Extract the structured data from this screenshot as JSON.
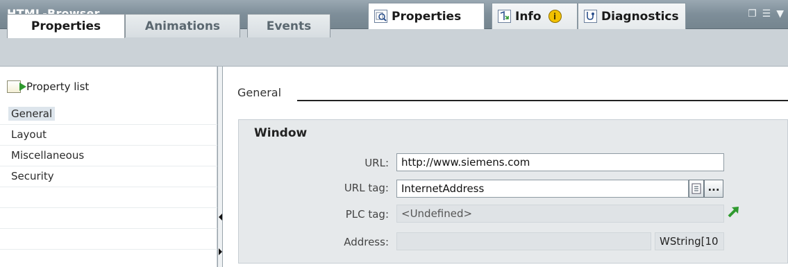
{
  "header": {
    "title": "HTML-Browser",
    "tabs": [
      {
        "label": "Properties",
        "icon": "properties-icon"
      },
      {
        "label": "Info",
        "icon": "info-icon",
        "badge": "i"
      },
      {
        "label": "Diagnostics",
        "icon": "diagnostics-icon"
      }
    ]
  },
  "tabs": [
    "Properties",
    "Animations",
    "Events"
  ],
  "sidebar": {
    "title": "Property list",
    "items": [
      "General",
      "Layout",
      "Miscellaneous",
      "Security"
    ]
  },
  "main": {
    "section_label": "General",
    "group_title": "Window",
    "fields": {
      "url": {
        "label": "URL:",
        "value": "http://www.siemens.com"
      },
      "url_tag": {
        "label": "URL tag:",
        "value": "InternetAddress"
      },
      "plc_tag": {
        "label": "PLC tag:",
        "value": "<Undefined>"
      },
      "address": {
        "label": "Address:",
        "value": "",
        "type": "WString[10"
      }
    },
    "browse_label": "..."
  },
  "colors": {
    "header_bg": "#8796a0",
    "tabbar_bg": "#cbd2d7",
    "panel_bg": "#e6e9eb",
    "goto_arrow": "#2f9a2f"
  }
}
